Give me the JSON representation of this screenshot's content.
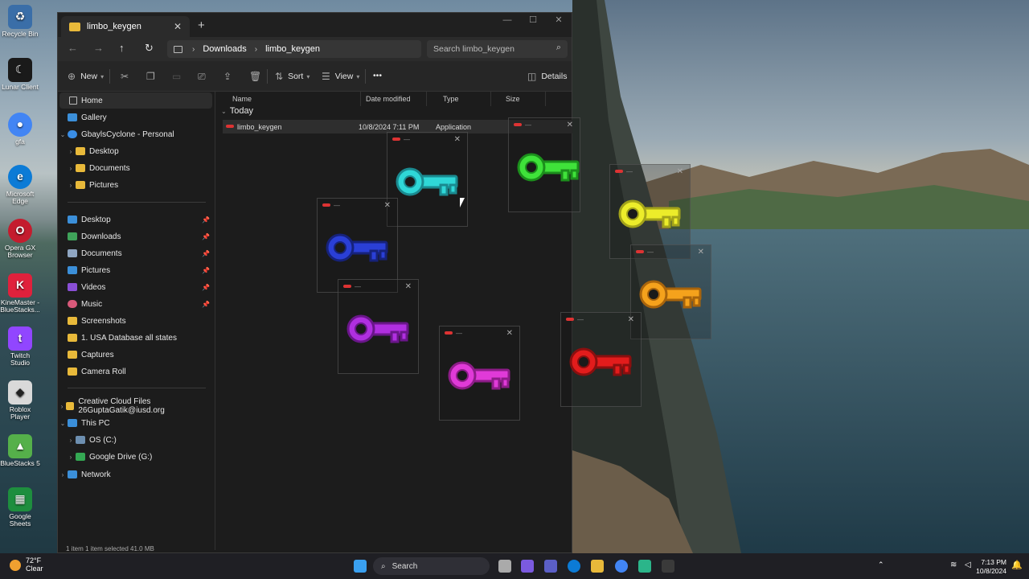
{
  "window": {
    "tab_title": "limbo_keygen",
    "close": "✕",
    "new_tab": "+",
    "min": "—",
    "max": "☐",
    "closewin": "✕"
  },
  "address": {
    "crumbs": [
      "Downloads",
      "limbo_keygen"
    ],
    "search_placeholder": "Search limbo_keygen"
  },
  "toolbar": {
    "new": "New",
    "sort": "Sort",
    "view": "View",
    "more": "•••",
    "details": "Details"
  },
  "nav": {
    "items": [
      {
        "label": "Home",
        "icon": "home-icon"
      },
      {
        "label": "Gallery",
        "icon": "gallery-icon"
      },
      {
        "label": "GbaylsCyclone - Personal",
        "icon": "cloud-icon"
      },
      {
        "label": "Desktop",
        "icon": "folder-icon"
      },
      {
        "label": "Documents",
        "icon": "folder-icon"
      },
      {
        "label": "Pictures",
        "icon": "folder-icon"
      }
    ],
    "quick": [
      {
        "label": "Desktop"
      },
      {
        "label": "Downloads"
      },
      {
        "label": "Documents"
      },
      {
        "label": "Pictures"
      },
      {
        "label": "Videos"
      },
      {
        "label": "Music"
      },
      {
        "label": "Screenshots"
      },
      {
        "label": "1. USA Database all states"
      },
      {
        "label": "Captures"
      },
      {
        "label": "Camera Roll"
      }
    ],
    "bottom": [
      {
        "label": "Creative Cloud Files  26GuptaGatik@iusd.org"
      },
      {
        "label": "This PC"
      },
      {
        "label": "OS (C:)"
      },
      {
        "label": "Google Drive (G:)"
      },
      {
        "label": "Network"
      }
    ]
  },
  "columns": [
    "Name",
    "Date modified",
    "Type",
    "Size"
  ],
  "group": "Today",
  "files": [
    {
      "name": "limbo_keygen",
      "date": "10/8/2024 7:11 PM",
      "type": "Application",
      "size": ""
    }
  ],
  "status": "1 item    1 item selected  41.0 MB",
  "desktop": {
    "icons": [
      "Recycle Bin",
      "Lunar Client",
      "gfa",
      "Microsoft Edge",
      "Opera GX Browser",
      "KineMaster - BlueStacks...",
      "Twitch Studio",
      "Roblox Player",
      "BlueStacks 5",
      "Google Sheets"
    ],
    "colors": [
      "#3a6ea8",
      "#1a1a1a",
      "#4285f4",
      "#0c7bd6",
      "#c41c2e",
      "#e0213c",
      "#9146ff",
      "#d9d9d9",
      "#55b04a",
      "#1e8e3e"
    ]
  },
  "keys": [
    {
      "color": "#2fd7d7",
      "shade": "#1a8a90"
    },
    {
      "color": "#3fe23a",
      "shade": "#1c8f1c"
    },
    {
      "color": "#ecec2a",
      "shade": "#a3a31a"
    },
    {
      "color": "#2a3fd6",
      "shade": "#16227a"
    },
    {
      "color": "#f5a21c",
      "shade": "#a8640c"
    },
    {
      "color": "#b02fe0",
      "shade": "#6a168a"
    },
    {
      "color": "#e03ad8",
      "shade": "#8d1c88"
    },
    {
      "color": "#e21c1c",
      "shade": "#8a0f0f"
    }
  ],
  "taskbar": {
    "weather_temp": "72°F",
    "weather_text": "Clear",
    "search": "Search",
    "time": "7:13 PM",
    "date": "10/8/2024"
  }
}
